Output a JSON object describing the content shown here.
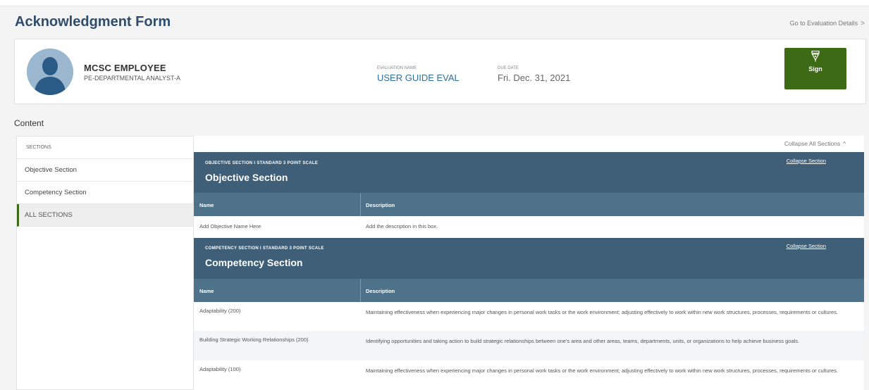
{
  "header": {
    "title": "Acknowledgment Form",
    "goto_link": "Go to Evaluation Details",
    "goto_chevron": ">"
  },
  "profile": {
    "name": "MCSC EMPLOYEE",
    "position": "PE-DEPARTMENTAL ANALYST-A",
    "evaluation_label": "EVALUATION NAME",
    "evaluation_name": "USER GUIDE EVAL",
    "due_label": "DUE DATE",
    "due_date": "Fri. Dec. 31, 2021",
    "sign_label": "Sign",
    "sign_color": "#3d6a14",
    "avatar_icon": "user-silhouette-icon",
    "sign_icon": "pen-nib-icon"
  },
  "content_heading": "Content",
  "sidebar": {
    "header": "SECTIONS",
    "items": [
      {
        "label": "Objective Section"
      },
      {
        "label": "Competency Section"
      },
      {
        "label": "ALL SECTIONS"
      }
    ],
    "active_color": "#3d6a14"
  },
  "main": {
    "collapse_all": "Collapse All Sections",
    "collapse_all_icon": "^",
    "section_color": "#3e5f77",
    "table_head_color": "#4d7289",
    "sections": [
      {
        "subtitle": "OBJECTIVE SECTION I STANDARD 3 POINT SCALE",
        "title": "Objective Section",
        "collapse": "Collapse Section",
        "columns": [
          "Name",
          "Description"
        ],
        "rows": [
          {
            "name": "Add Objective Name Here",
            "description": "Add the description in this box."
          }
        ]
      },
      {
        "subtitle": "COMPETENCY SECTION I STANDARD 3 POINT SCALE",
        "title": "Competency Section",
        "collapse": "Collapse Section",
        "columns": [
          "Name",
          "Description"
        ],
        "rows": [
          {
            "name": "Adaptability (200)",
            "description": "Maintaining effectiveness when experiencing major changes in personal work tasks or the work environment; adjusting effectively to work within new work structures, processes, requirements or cultures."
          },
          {
            "name": "Building Strategic Working Relationships (200)",
            "description": "Identifying opportunities and taking action to build strategic relationships between one's area and other areas, teams, departments, units, or organizations to help achieve business goals."
          },
          {
            "name": "Adaptability (100)",
            "description": "Maintaining effectiveness when experiencing major changes in personal work tasks or the work environment; adjusting effectively to work within new work structures, processes, requirements or cultures."
          }
        ]
      }
    ]
  }
}
